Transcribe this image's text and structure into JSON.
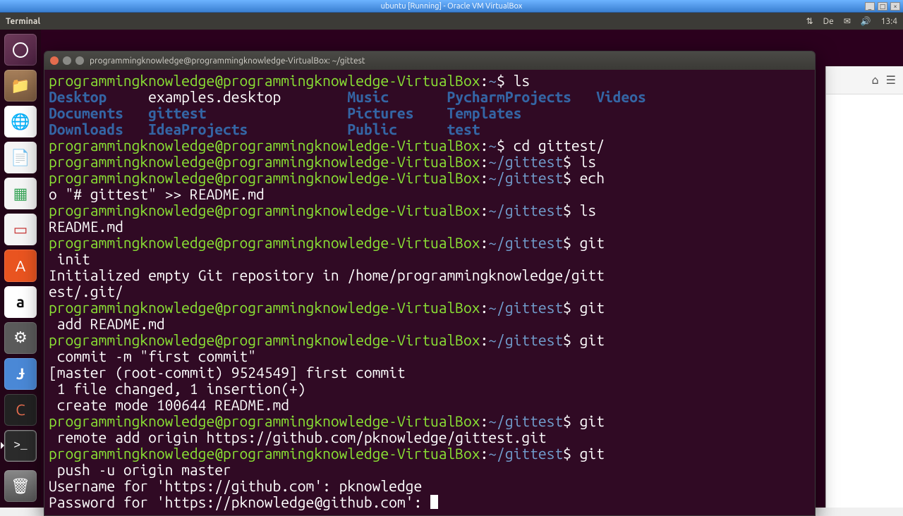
{
  "vbox": {
    "title": "ubuntu [Running] - Oracle VM VirtualBox"
  },
  "ubuntu_top": {
    "app": "Terminal",
    "lang": "De",
    "time": "13:4"
  },
  "launcher": {
    "items": [
      {
        "name": "dash",
        "glyph": "◌"
      },
      {
        "name": "files",
        "glyph": "🗂"
      },
      {
        "name": "firefox",
        "glyph": "🦊"
      },
      {
        "name": "writer",
        "glyph": "📄"
      },
      {
        "name": "calc",
        "glyph": "📊"
      },
      {
        "name": "impress",
        "glyph": "📽"
      },
      {
        "name": "software-center",
        "glyph": "A"
      },
      {
        "name": "amazon",
        "glyph": "a"
      },
      {
        "name": "settings",
        "glyph": "⚙"
      },
      {
        "name": "jd",
        "glyph": "Ɉ"
      },
      {
        "name": "ccleaner",
        "glyph": "🧹"
      },
      {
        "name": "terminal",
        "glyph": ">_"
      },
      {
        "name": "trash",
        "glyph": "🗑"
      }
    ]
  },
  "terminal": {
    "title": "programmingknowledge@programmingknowledge-VirtualBox: ~/gittest",
    "prompt_user": "programmingknowledge@programmingknowledge-VirtualBox",
    "home_path": "~",
    "gittest_path": "~/gittest",
    "ls_columns": [
      [
        "Desktop",
        "Documents",
        "Downloads"
      ],
      [
        "examples.desktop",
        "gittest",
        "IdeaProjects"
      ],
      [
        "Music",
        "Pictures",
        "Public"
      ],
      [
        "PycharmProjects",
        "Templates",
        "test"
      ],
      [
        "Videos",
        "",
        ""
      ]
    ],
    "cmds": {
      "ls": "ls",
      "cd": "cd gittest/",
      "ls2": "ls",
      "echo": "echo \"# gittest\" >> README.md",
      "ls3": "ls",
      "readme": "README.md",
      "gitinit": "git init",
      "init_out": "Initialized empty Git repository in /home/programmingknowledge/gittest/.git/",
      "gitadd": "git add README.md",
      "gitcommit": "git commit -m \"first commit\"",
      "commit_out1": "[master (root-commit) 9524549] first commit",
      "commit_out2": " 1 file changed, 1 insertion(+)",
      "commit_out3": " create mode 100644 README.md",
      "gitremote": "git remote add origin https://github.com/pknowledge/gittest.git",
      "gitpush": "git push -u origin master",
      "user_prompt": "Username for 'https://github.com': ",
      "user_val": "pknowledge",
      "pass_prompt": "Password for 'https://pknowledge@github.com': "
    }
  }
}
